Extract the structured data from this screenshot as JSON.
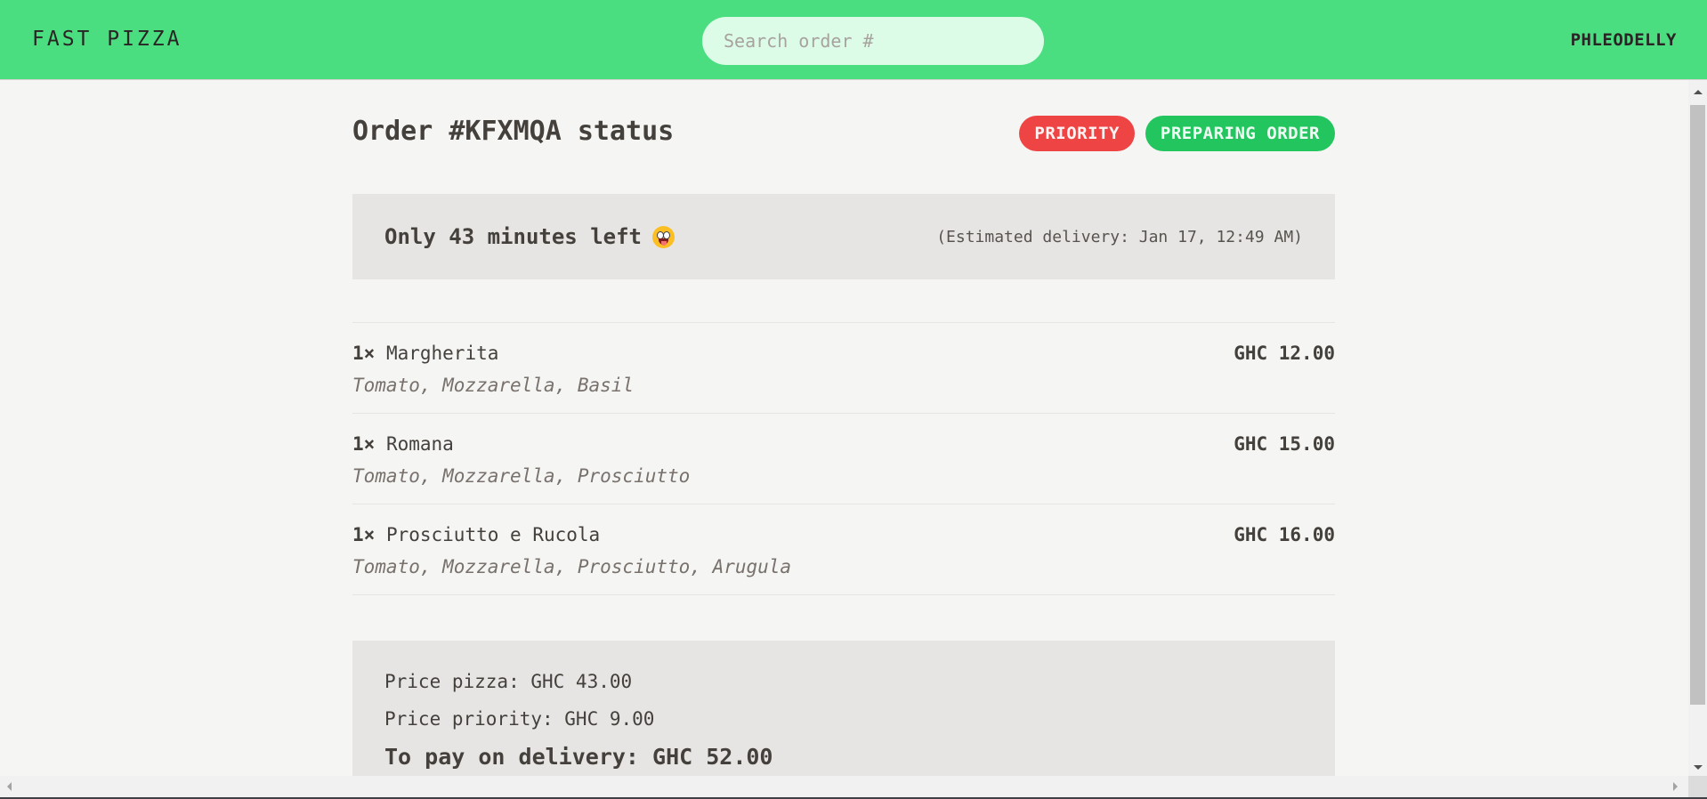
{
  "header": {
    "logo": "FAST PIZZA",
    "search_placeholder": "Search order #",
    "username": "PHLEODELLY"
  },
  "order": {
    "title": "Order #KFXMQA status",
    "badges": {
      "priority": "PRIORITY",
      "status": "PREPARING ORDER"
    },
    "eta": {
      "main": "Only 43 minutes left",
      "emoji": "grinning-face-with-tongue-icon",
      "estimated": "(Estimated delivery: Jan 17, 12:49 AM)"
    },
    "items": [
      {
        "qty": "1×",
        "name": "Margherita",
        "price": "GHC 12.00",
        "ingredients": "Tomato, Mozzarella, Basil"
      },
      {
        "qty": "1×",
        "name": "Romana",
        "price": "GHC 15.00",
        "ingredients": "Tomato, Mozzarella, Prosciutto"
      },
      {
        "qty": "1×",
        "name": "Prosciutto e Rucola",
        "price": "GHC 16.00",
        "ingredients": "Tomato, Mozzarella, Prosciutto, Arugula"
      }
    ],
    "summary": {
      "price_pizza": "Price pizza: GHC 43.00",
      "price_priority": "Price priority: GHC 9.00",
      "to_pay": "To pay on delivery: GHC 52.00"
    }
  },
  "colors": {
    "header_bg": "#4ade80",
    "priority_badge": "#ef4444",
    "status_badge": "#22c55e",
    "panel_bg": "#e7e5e4"
  }
}
